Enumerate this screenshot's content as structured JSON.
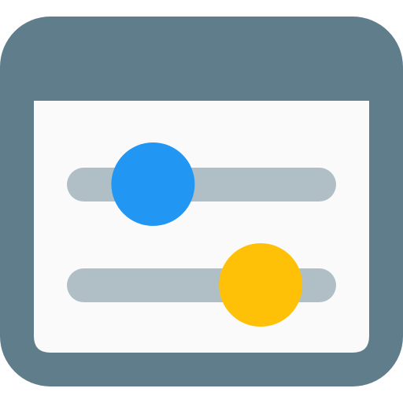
{
  "icon": {
    "name": "settings-sliders-icon",
    "colors": {
      "frame": "#607D8B",
      "content": "#FAFAFA",
      "track": "#B0BEC5",
      "knob_top": "#2196F3",
      "knob_bottom": "#FFC107"
    },
    "sliders": [
      {
        "name": "top-slider",
        "level": 0.32
      },
      {
        "name": "bottom-slider",
        "level": 0.72
      }
    ]
  }
}
